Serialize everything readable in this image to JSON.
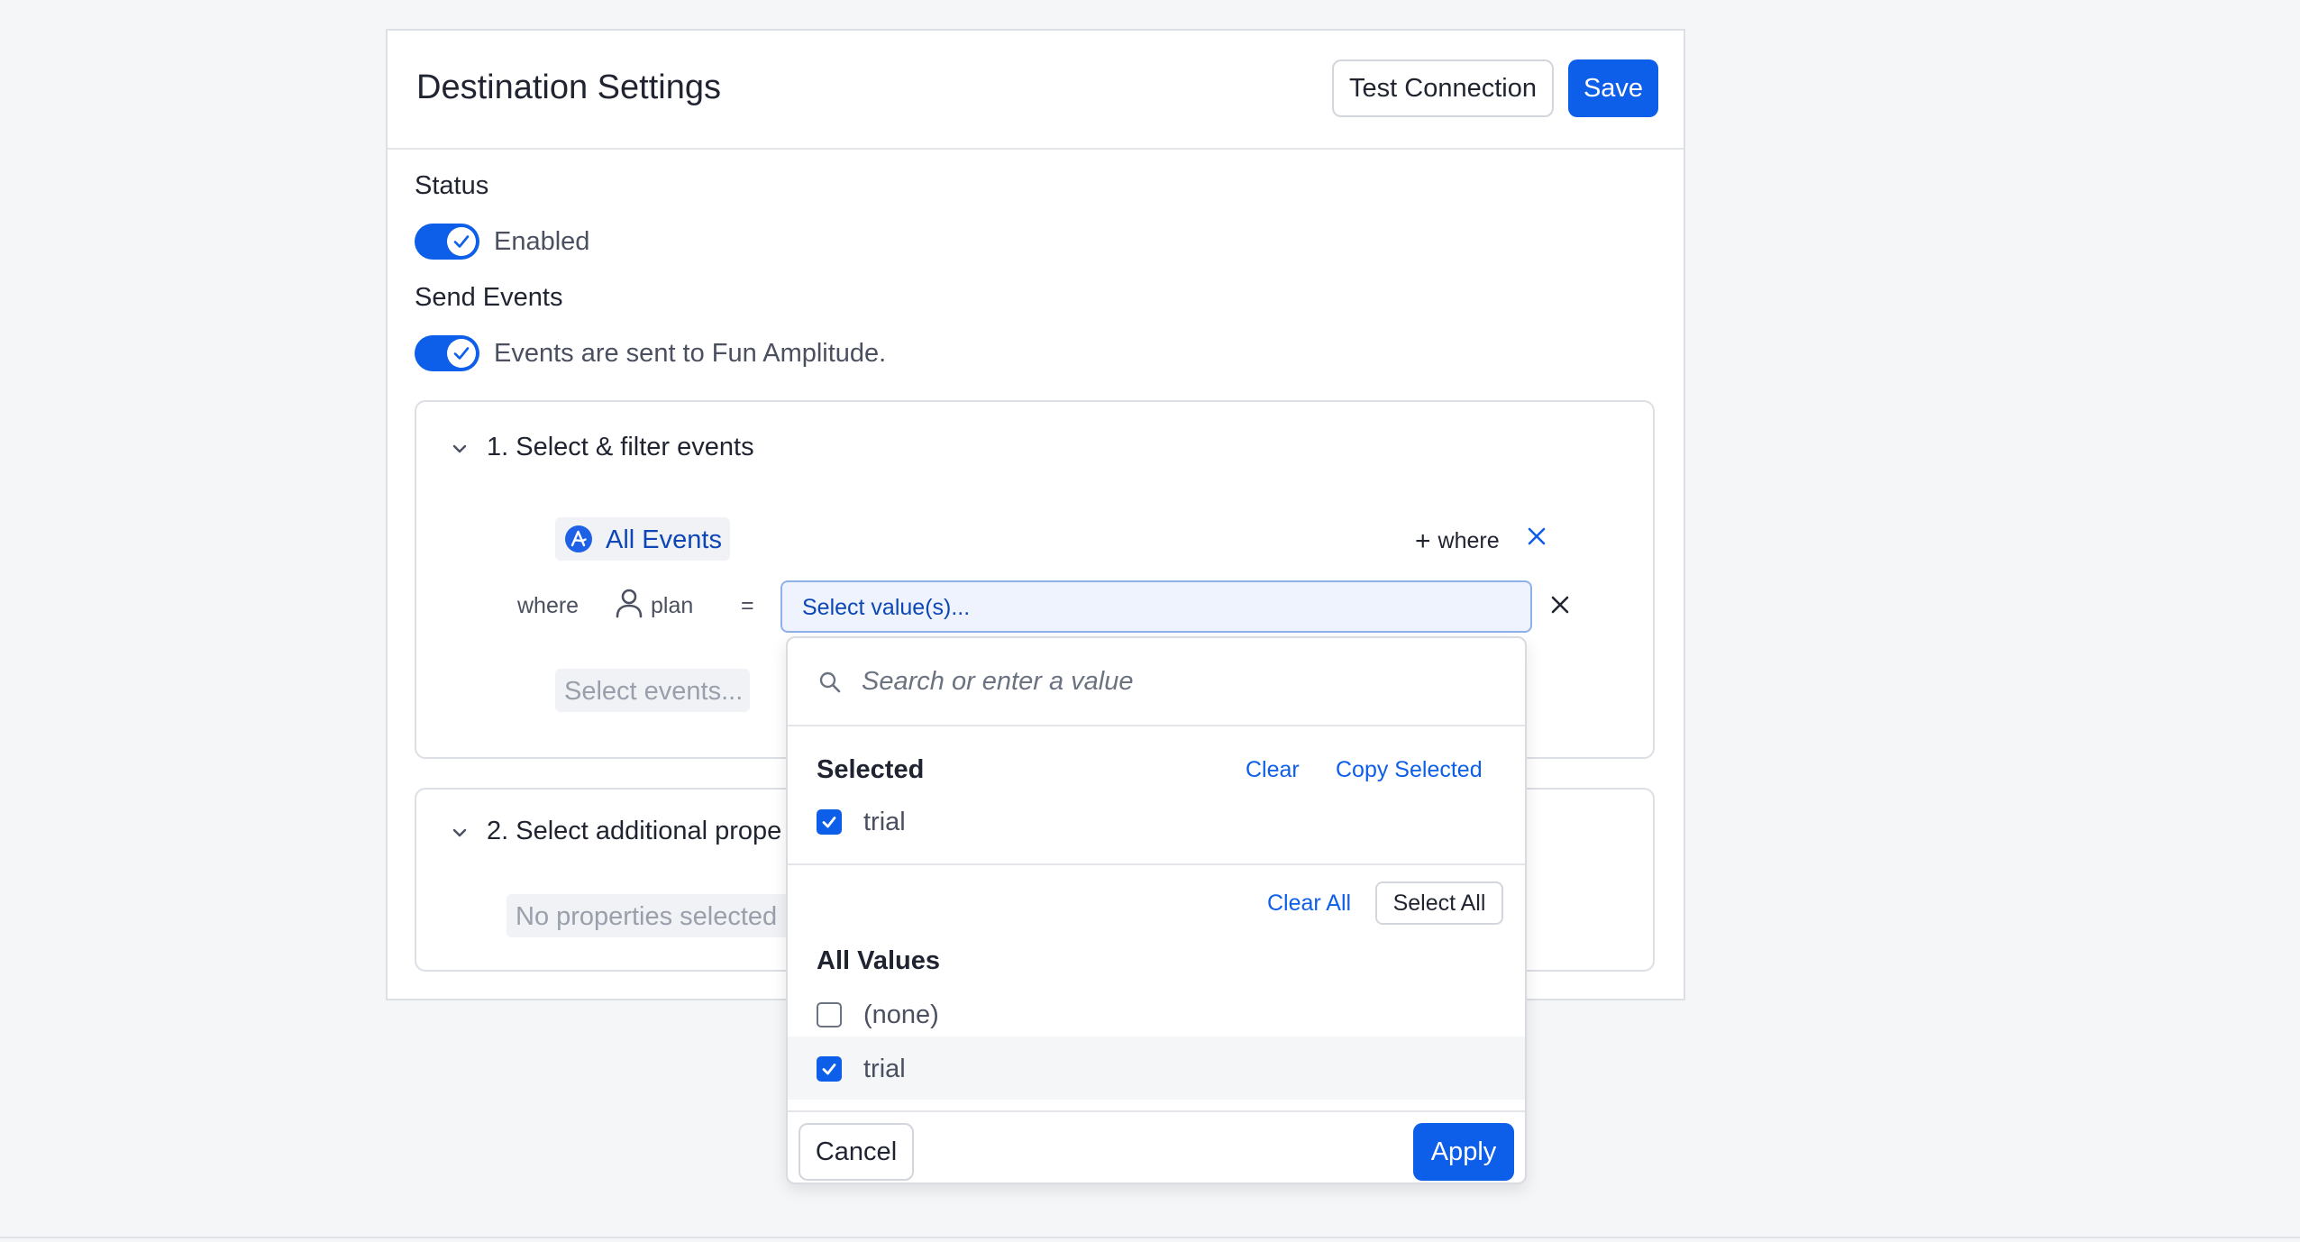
{
  "header": {
    "title": "Destination Settings",
    "test_connection_label": "Test Connection",
    "save_label": "Save"
  },
  "status": {
    "label": "Status",
    "toggle_text": "Enabled",
    "enabled": true
  },
  "send_events": {
    "label": "Send Events",
    "toggle_text": "Events are sent to Fun Amplitude.",
    "enabled": true
  },
  "section1": {
    "title": "1. Select & filter events",
    "event_chip": "All Events",
    "add_where": "where",
    "filter": {
      "where_label": "where",
      "property": "plan",
      "operator": "=",
      "value_placeholder": "Select value(s)..."
    },
    "select_events_placeholder": "Select events..."
  },
  "section2": {
    "title": "2. Select additional prope",
    "no_properties": "No properties selected"
  },
  "dropdown": {
    "search_placeholder": "Search or enter a value",
    "selected_heading": "Selected",
    "clear_label": "Clear",
    "copy_selected_label": "Copy Selected",
    "selected_items": [
      {
        "label": "trial",
        "checked": true
      }
    ],
    "clear_all_label": "Clear All",
    "select_all_label": "Select All",
    "all_values_heading": "All Values",
    "values": [
      {
        "label": "(none)",
        "checked": false
      },
      {
        "label": "trial",
        "checked": true
      }
    ],
    "cancel_label": "Cancel",
    "apply_label": "Apply"
  },
  "colors": {
    "accent": "#0d5ee8",
    "link": "#0d47b5"
  }
}
